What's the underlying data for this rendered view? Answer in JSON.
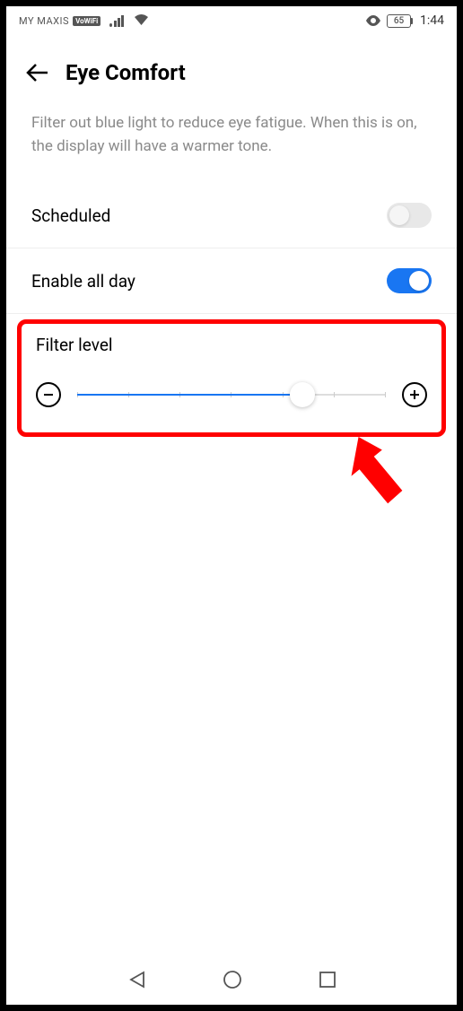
{
  "status_bar": {
    "carrier": "MY MAXIS",
    "vowifi": "VoWiFi",
    "battery_pct": "65",
    "time": "1:44"
  },
  "header": {
    "title": "Eye Comfort"
  },
  "description": "Filter out blue light to reduce eye fatigue. When this is on, the display will have a warmer tone.",
  "settings": {
    "scheduled": {
      "label": "Scheduled",
      "enabled": false
    },
    "enable_all_day": {
      "label": "Enable all day",
      "enabled": true
    },
    "filter_level": {
      "label": "Filter level",
      "value": 73
    }
  }
}
